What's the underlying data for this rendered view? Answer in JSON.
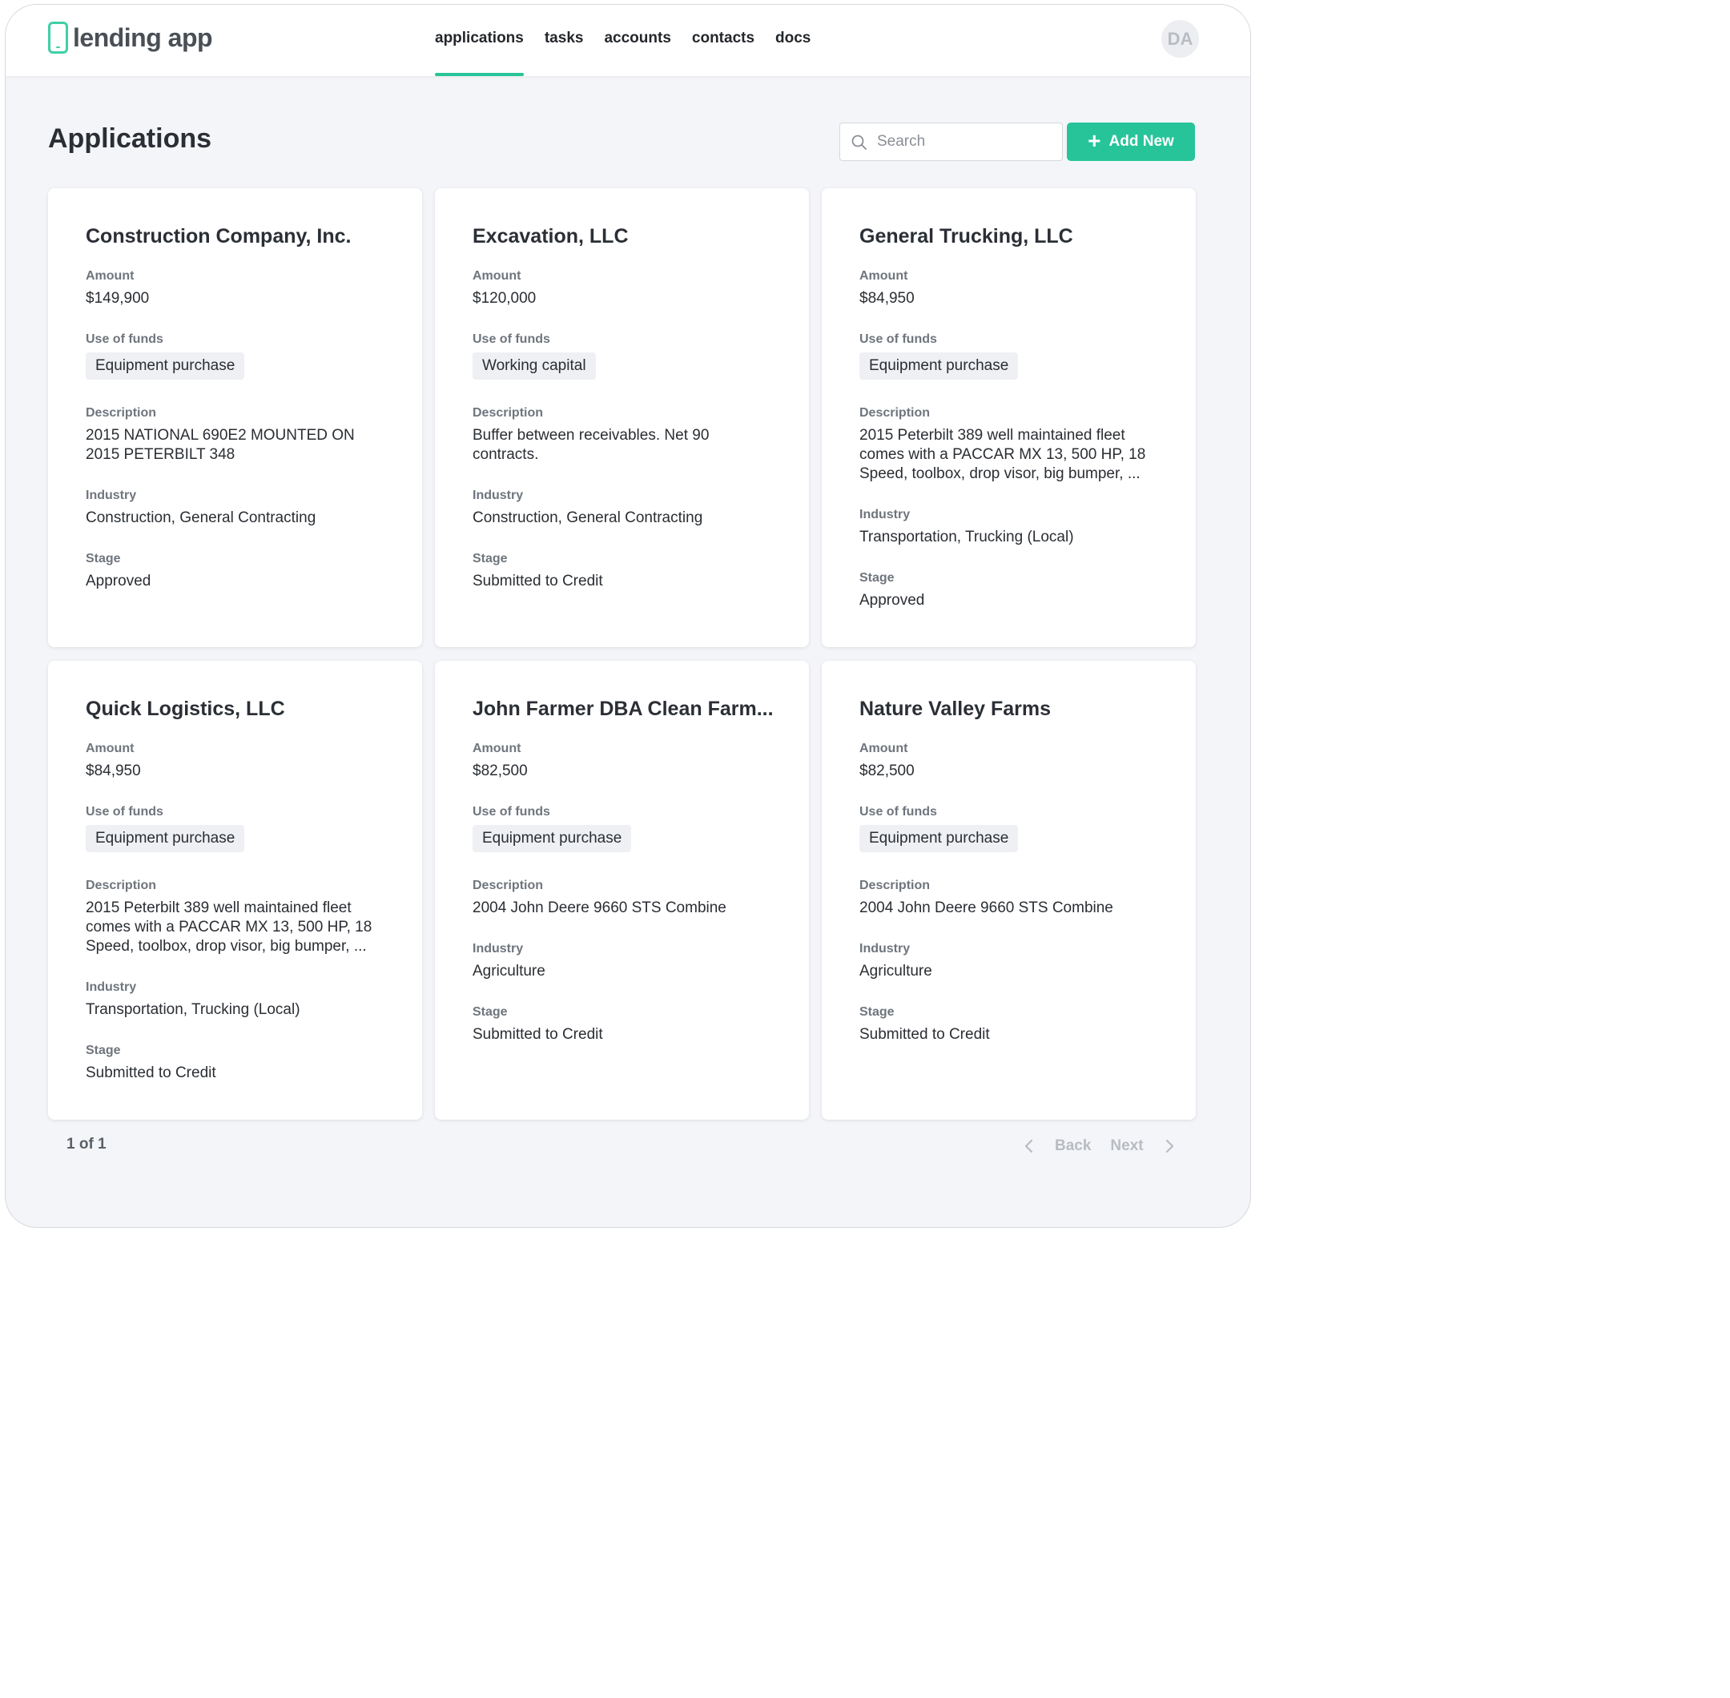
{
  "header": {
    "logo_text": "lending app",
    "nav": [
      {
        "label": "applications"
      },
      {
        "label": "tasks"
      },
      {
        "label": "accounts"
      },
      {
        "label": "contacts"
      },
      {
        "label": "docs"
      }
    ],
    "avatar_initials": "DA"
  },
  "page": {
    "title": "Applications",
    "search_placeholder": "Search",
    "add_button_label": "Add New"
  },
  "labels": {
    "amount": "Amount",
    "use_of_funds": "Use of funds",
    "description": "Description",
    "industry": "Industry",
    "stage": "Stage"
  },
  "applications": [
    {
      "company": "Construction Company, Inc.",
      "amount": "$149,900",
      "use_of_funds": "Equipment purchase",
      "description": "2015 NATIONAL 690E2 MOUNTED ON 2015 PETERBILT 348",
      "industry": "Construction, General Contracting",
      "stage": "Approved"
    },
    {
      "company": "Excavation, LLC",
      "amount": "$120,000",
      "use_of_funds": "Working capital",
      "description": "Buffer between receivables. Net 90 contracts.",
      "industry": "Construction, General Contracting",
      "stage": "Submitted to Credit"
    },
    {
      "company": "General Trucking, LLC",
      "amount": "$84,950",
      "use_of_funds": "Equipment purchase",
      "description": "2015 Peterbilt 389 well maintained fleet comes with a PACCAR MX 13, 500 HP, 18 Speed, toolbox, drop visor, big bumper, ...",
      "industry": "Transportation, Trucking (Local)",
      "stage": "Approved"
    },
    {
      "company": "Quick Logistics, LLC",
      "amount": "$84,950",
      "use_of_funds": "Equipment purchase",
      "description": "2015 Peterbilt 389 well maintained fleet comes with a PACCAR MX 13, 500 HP, 18 Speed, toolbox, drop visor, big bumper, ...",
      "industry": "Transportation, Trucking (Local)",
      "stage": "Submitted to Credit"
    },
    {
      "company": "John Farmer DBA Clean Farm...",
      "amount": "$82,500",
      "use_of_funds": "Equipment purchase",
      "description": "2004 John Deere 9660 STS Combine",
      "industry": "Agriculture",
      "stage": "Submitted to Credit"
    },
    {
      "company": "Nature Valley Farms",
      "amount": "$82,500",
      "use_of_funds": "Equipment purchase",
      "description": "2004 John Deere 9660 STS Combine",
      "industry": "Agriculture",
      "stage": "Submitted to Credit"
    }
  ],
  "pagination": {
    "page_text": "1 of 1",
    "back_label": "Back",
    "next_label": "Next"
  },
  "colors": {
    "accent": "#27c49a",
    "logo_accent": "#3fd0a6",
    "background": "#f4f5f8"
  }
}
